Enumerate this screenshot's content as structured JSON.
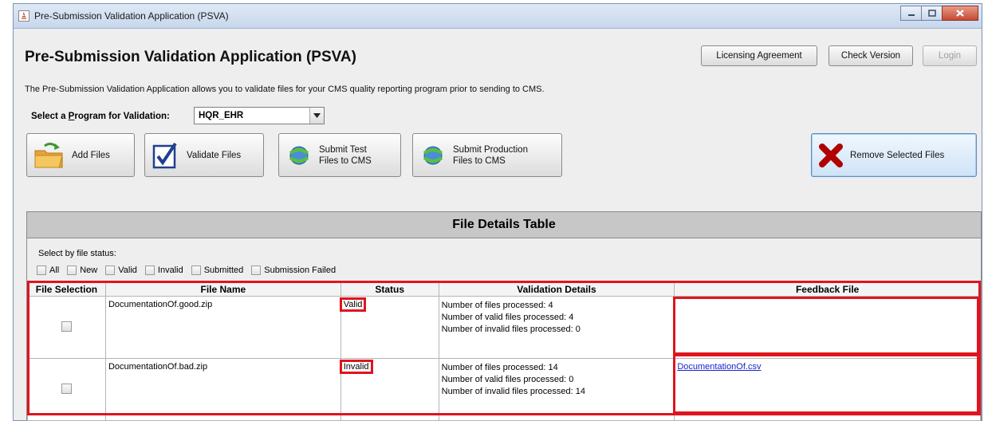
{
  "window": {
    "title": "Pre-Submission Validation Application (PSVA)"
  },
  "header": {
    "title": "Pre-Submission Validation Application (PSVA)",
    "buttons": {
      "licensing": "Licensing Agreement",
      "check_version": "Check Version",
      "login": "Login"
    },
    "description": "The Pre-Submission Validation Application allows you to validate files for your CMS quality reporting program prior to sending to CMS."
  },
  "program": {
    "label_pre": "Select a ",
    "label_underlined": "P",
    "label_post": "rogram for Validation:",
    "selected": "HQR_EHR"
  },
  "toolbar": {
    "add_files": "Add Files",
    "validate_files": "Validate Files",
    "submit_test_line1": "Submit Test",
    "submit_test_line2": "Files to CMS",
    "submit_prod_line1": "Submit Production",
    "submit_prod_line2": "Files to CMS",
    "remove_selected": "Remove Selected Files"
  },
  "table": {
    "title": "File Details Table",
    "filter_label": "Select by file status:",
    "filters": [
      "All",
      "New",
      "Valid",
      "Invalid",
      "Submitted",
      "Submission Failed"
    ],
    "columns": [
      "File Selection",
      "File Name",
      "Status",
      "Validation Details",
      "Feedback File"
    ],
    "rows": [
      {
        "file_name": "DocumentationOf.good.zip",
        "status": "Valid",
        "details": [
          "Number of files processed: 4",
          "Number of valid files processed: 4",
          "Number of invalid files processed: 0"
        ],
        "feedback": ""
      },
      {
        "file_name": "DocumentationOf.bad.zip",
        "status": "Invalid",
        "details": [
          "Number of files processed: 14",
          "Number of valid files processed: 0",
          "Number of invalid files processed: 14"
        ],
        "feedback": "DocumentationOf.csv"
      }
    ]
  },
  "colors": {
    "highlight": "#e0141e",
    "link": "#1a22c8",
    "remove_icon": "#b00000"
  }
}
